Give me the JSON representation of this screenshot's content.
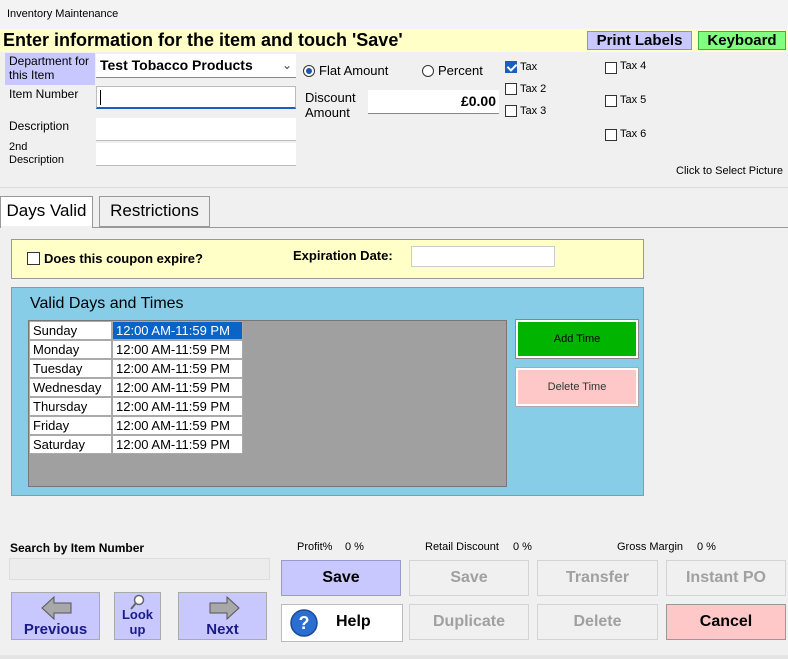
{
  "window": {
    "title": "Inventory Maintenance"
  },
  "header": {
    "instruction": "Enter information for the item and touch 'Save'",
    "print_labels": "Print Labels",
    "keyboard": "Keyboard"
  },
  "item": {
    "department_label": "Department for this Item",
    "department_value": "Test Tobacco Products",
    "item_number_label": "Item Number",
    "item_number_value": "",
    "description_label": "Description",
    "description_value": "",
    "second_description_label": "2nd Description",
    "second_description_value": ""
  },
  "discount": {
    "flat_amount_label": "Flat Amount",
    "flat_amount_selected": true,
    "percent_label": "Percent",
    "percent_selected": false,
    "amount_label": "Discount Amount",
    "amount_value": "£0.00"
  },
  "taxes": [
    {
      "label": "Tax",
      "checked": true
    },
    {
      "label": "Tax 2",
      "checked": false
    },
    {
      "label": "Tax 3",
      "checked": false
    },
    {
      "label": "Tax 4",
      "checked": false
    },
    {
      "label": "Tax 5",
      "checked": false
    },
    {
      "label": "Tax 6",
      "checked": false
    }
  ],
  "picture": {
    "hint": "Click to Select Picture"
  },
  "tabs": [
    {
      "label": "Days Valid",
      "active": true
    },
    {
      "label": "Restrictions",
      "active": false
    }
  ],
  "expiry": {
    "question": "Does this coupon expire?",
    "checked": false,
    "date_label": "Expiration Date:",
    "date_value": ""
  },
  "valid_days": {
    "title": "Valid Days and Times",
    "rows": [
      {
        "day": "Sunday",
        "time": "12:00 AM-11:59 PM",
        "selected": true
      },
      {
        "day": "Monday",
        "time": "12:00 AM-11:59 PM",
        "selected": false
      },
      {
        "day": "Tuesday",
        "time": "12:00 AM-11:59 PM",
        "selected": false
      },
      {
        "day": "Wednesday",
        "time": "12:00 AM-11:59 PM",
        "selected": false
      },
      {
        "day": "Thursday",
        "time": "12:00 AM-11:59 PM",
        "selected": false
      },
      {
        "day": "Friday",
        "time": "12:00 AM-11:59 PM",
        "selected": false
      },
      {
        "day": "Saturday",
        "time": "12:00 AM-11:59 PM",
        "selected": false
      }
    ],
    "add_time": "Add Time",
    "delete_time": "Delete Time"
  },
  "search": {
    "label": "Search by Item Number",
    "value": ""
  },
  "stats": {
    "profit_label": "Profit%",
    "profit_value": "0 %",
    "retail_discount_label": "Retail Discount",
    "retail_discount_value": "0 %",
    "gross_margin_label": "Gross Margin",
    "gross_margin_value": "0 %"
  },
  "nav": {
    "previous": "Previous",
    "lookup_line1": "Look",
    "lookup_line2": "up",
    "next": "Next"
  },
  "actions": {
    "save": "Save",
    "save_disabled": "Save",
    "transfer": "Transfer",
    "instant_po": "Instant PO",
    "help": "Help",
    "duplicate": "Duplicate",
    "delete": "Delete",
    "cancel": "Cancel"
  },
  "colors": {
    "instruction_bg": "#ffffc8",
    "lavender": "#c8c8ff",
    "keyboard_green": "#80ff80",
    "panel_blue": "#87cde8",
    "add_green": "#00b400",
    "delete_pink": "#ffc8c8",
    "selection_blue": "#0a64c8"
  }
}
